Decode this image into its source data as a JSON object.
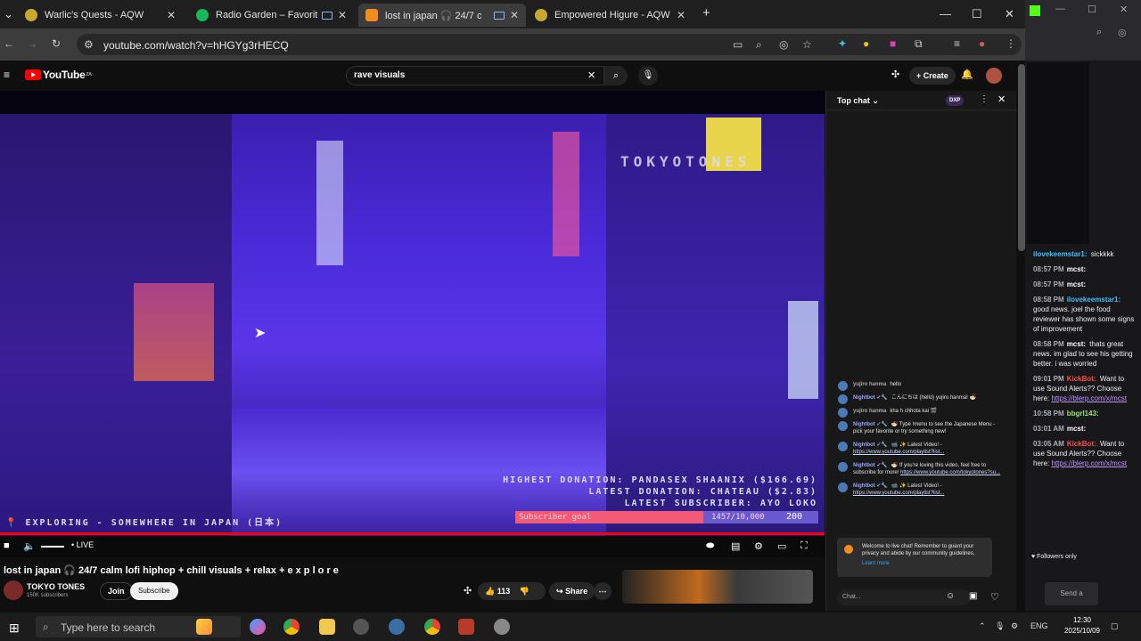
{
  "browser": {
    "tabs": [
      {
        "title": "Warlic's Quests - AQW",
        "color": "#c8a832"
      },
      {
        "title": "Radio Garden – Favorites",
        "color": "#17b85a"
      },
      {
        "title": "lost in japan 🎧 24/7 c",
        "color": "#f28b20"
      },
      {
        "title": "Empowered Higure - AQW",
        "color": "#c8a832"
      }
    ],
    "url": "youtube.com/watch?v=hHGYg3rHECQ"
  },
  "youtube": {
    "logo_text": "YouTube",
    "country": "ZA",
    "search_value": "rave visuals",
    "create_label": "Create"
  },
  "video": {
    "overlay_brand": "TOKYOTONES",
    "overlay_location": "📍 EXPLORING - SOMEWHERE IN JAPAN (日本)",
    "overlay_highest": "HIGHEST DONATION: PANDASEX SHAANIX ($166.69)",
    "overlay_latest": "LATEST DONATION: CHATEAU ($2.83)",
    "overlay_subscriber": "LATEST SUBSCRIBER: AYO LOKO",
    "subgoal_label": "Subscriber goal",
    "subgoal_count": "1457/10,000",
    "subgoal_number": "200",
    "subgoal_progress": 0.62,
    "live_label": "• LIVE",
    "title": "lost in japan 🎧 24/7 calm lofi hiphop + chill visuals + relax + e x p l o r e",
    "channel": "TOKYO TONES",
    "subscribers": "150K subscribers",
    "join_label": "Join",
    "subscribe_label": "Subscribe",
    "likes": "113",
    "share_label": "Share"
  },
  "chat": {
    "header": "Top chat",
    "badge": "DXP",
    "messages": [
      {
        "author": "yujiro hanma",
        "text": "hello",
        "plain": true
      },
      {
        "author": "Nightbot ✓🔧",
        "text": "こんにちは (hello) yujiro hanma! 🍜"
      },
      {
        "author": "yujiro hanma",
        "text": "kha h chhota kai 🎬",
        "plain": true
      },
      {
        "author": "Nightbot ✓🔧",
        "text": "🍜 Type !menu to see the Japanese Menu - pick your favorite or try something new!"
      },
      {
        "author": "Nightbot ✓🔧",
        "text": "📹 ✨ Latest Video! - ",
        "link": "https://www.youtube.com/playlist?list..."
      },
      {
        "author": "Nightbot ✓🔧",
        "text": "🍜 If you're loving this video, feel free to subscribe for more! ",
        "link": "https://www.youtube.com/tokyotones?su..."
      },
      {
        "author": "Nightbot ✓🔧",
        "text": "📹 ✨ Latest Video! - ",
        "link": "https://www.youtube.com/playlist?list..."
      }
    ],
    "notice": "Welcome to live chat! Remember to guard your privacy and abide by our community guidelines.",
    "learn_more": "Learn more",
    "input_placeholder": "Chat..."
  },
  "twitch": {
    "messages": [
      {
        "time": "",
        "user": "ilovekeemstar1:",
        "text": "sickkkk",
        "color": "#3fbfff"
      },
      {
        "time": "08:57 PM",
        "user": "mcst:",
        "text": "",
        "color": "#ffffff"
      },
      {
        "time": "08:57 PM",
        "user": "mcst:",
        "text": "",
        "color": "#ffffff"
      },
      {
        "time": "08:58 PM",
        "user": "ilovekeemstar1:",
        "text": "good news. joel the food reviewer has shown some signs of improvement",
        "color": "#3fbfff"
      },
      {
        "time": "08:58 PM",
        "user": "mcst:",
        "text": "thats great news. im glad to see his getting better. i was worried",
        "color": "#ffffff"
      },
      {
        "time": "09:01 PM",
        "user": "KickBot:",
        "text": "Want to use Sound Alerts?? Choose here: ",
        "link": "https://blerp.com/x/mcst",
        "color": "#ff4d4d"
      },
      {
        "time": "10:58 PM",
        "user": "bbgrl143:",
        "text": "",
        "color": "#9be07a"
      },
      {
        "time": "03:01 AM",
        "user": "mcst:",
        "text": "",
        "color": "#ffffff"
      },
      {
        "time": "03:05 AM",
        "user": "KickBot:",
        "text": "Want to use Sound Alerts?? Choose here: ",
        "link": "https://blerp.com/x/mcst",
        "color": "#ff4d4d"
      }
    ],
    "followers_only": "Followers only",
    "send_placeholder": "Send a message"
  },
  "taskbar": {
    "search_placeholder": "Type here to search",
    "lang": "ENG",
    "time": "12:30",
    "date": "2025/10/09"
  }
}
